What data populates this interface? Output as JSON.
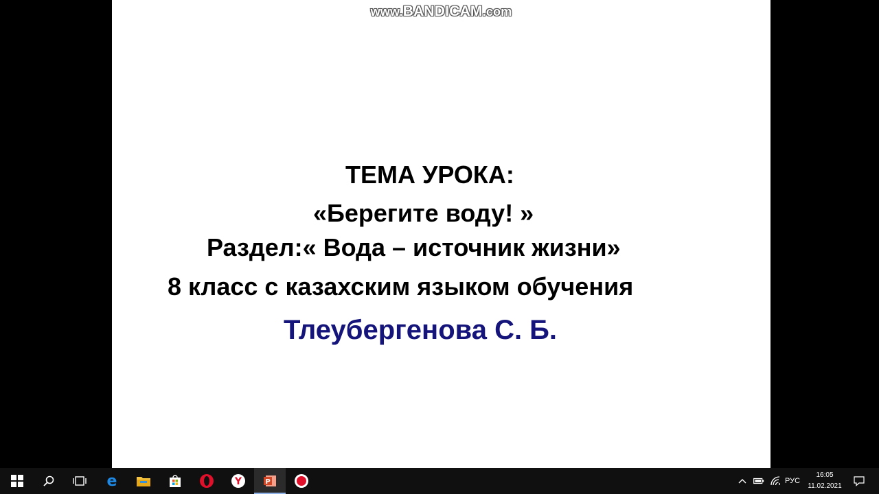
{
  "watermark": {
    "prefix": "www.",
    "brand": "BANDICAM",
    "suffix": ".com"
  },
  "slide": {
    "line1": "ТЕМА УРОКА:",
    "line2": "«Берегите воду! »",
    "line3": "Раздел:« Вода – источник жизни»",
    "line4": "8 класс с казахским языком обучения",
    "line5": "Тлеубергенова С. Б.",
    "author_color": "#14147a"
  },
  "taskbar": {
    "icons": [
      "windows-start-icon",
      "search-icon",
      "task-view-icon",
      "edge-icon",
      "file-explorer-icon",
      "store-icon",
      "opera-icon",
      "yandex-icon",
      "powerpoint-icon",
      "record-icon"
    ],
    "tray": {
      "language": "РУС",
      "time": "16:05",
      "date": "11.02.2021"
    }
  }
}
